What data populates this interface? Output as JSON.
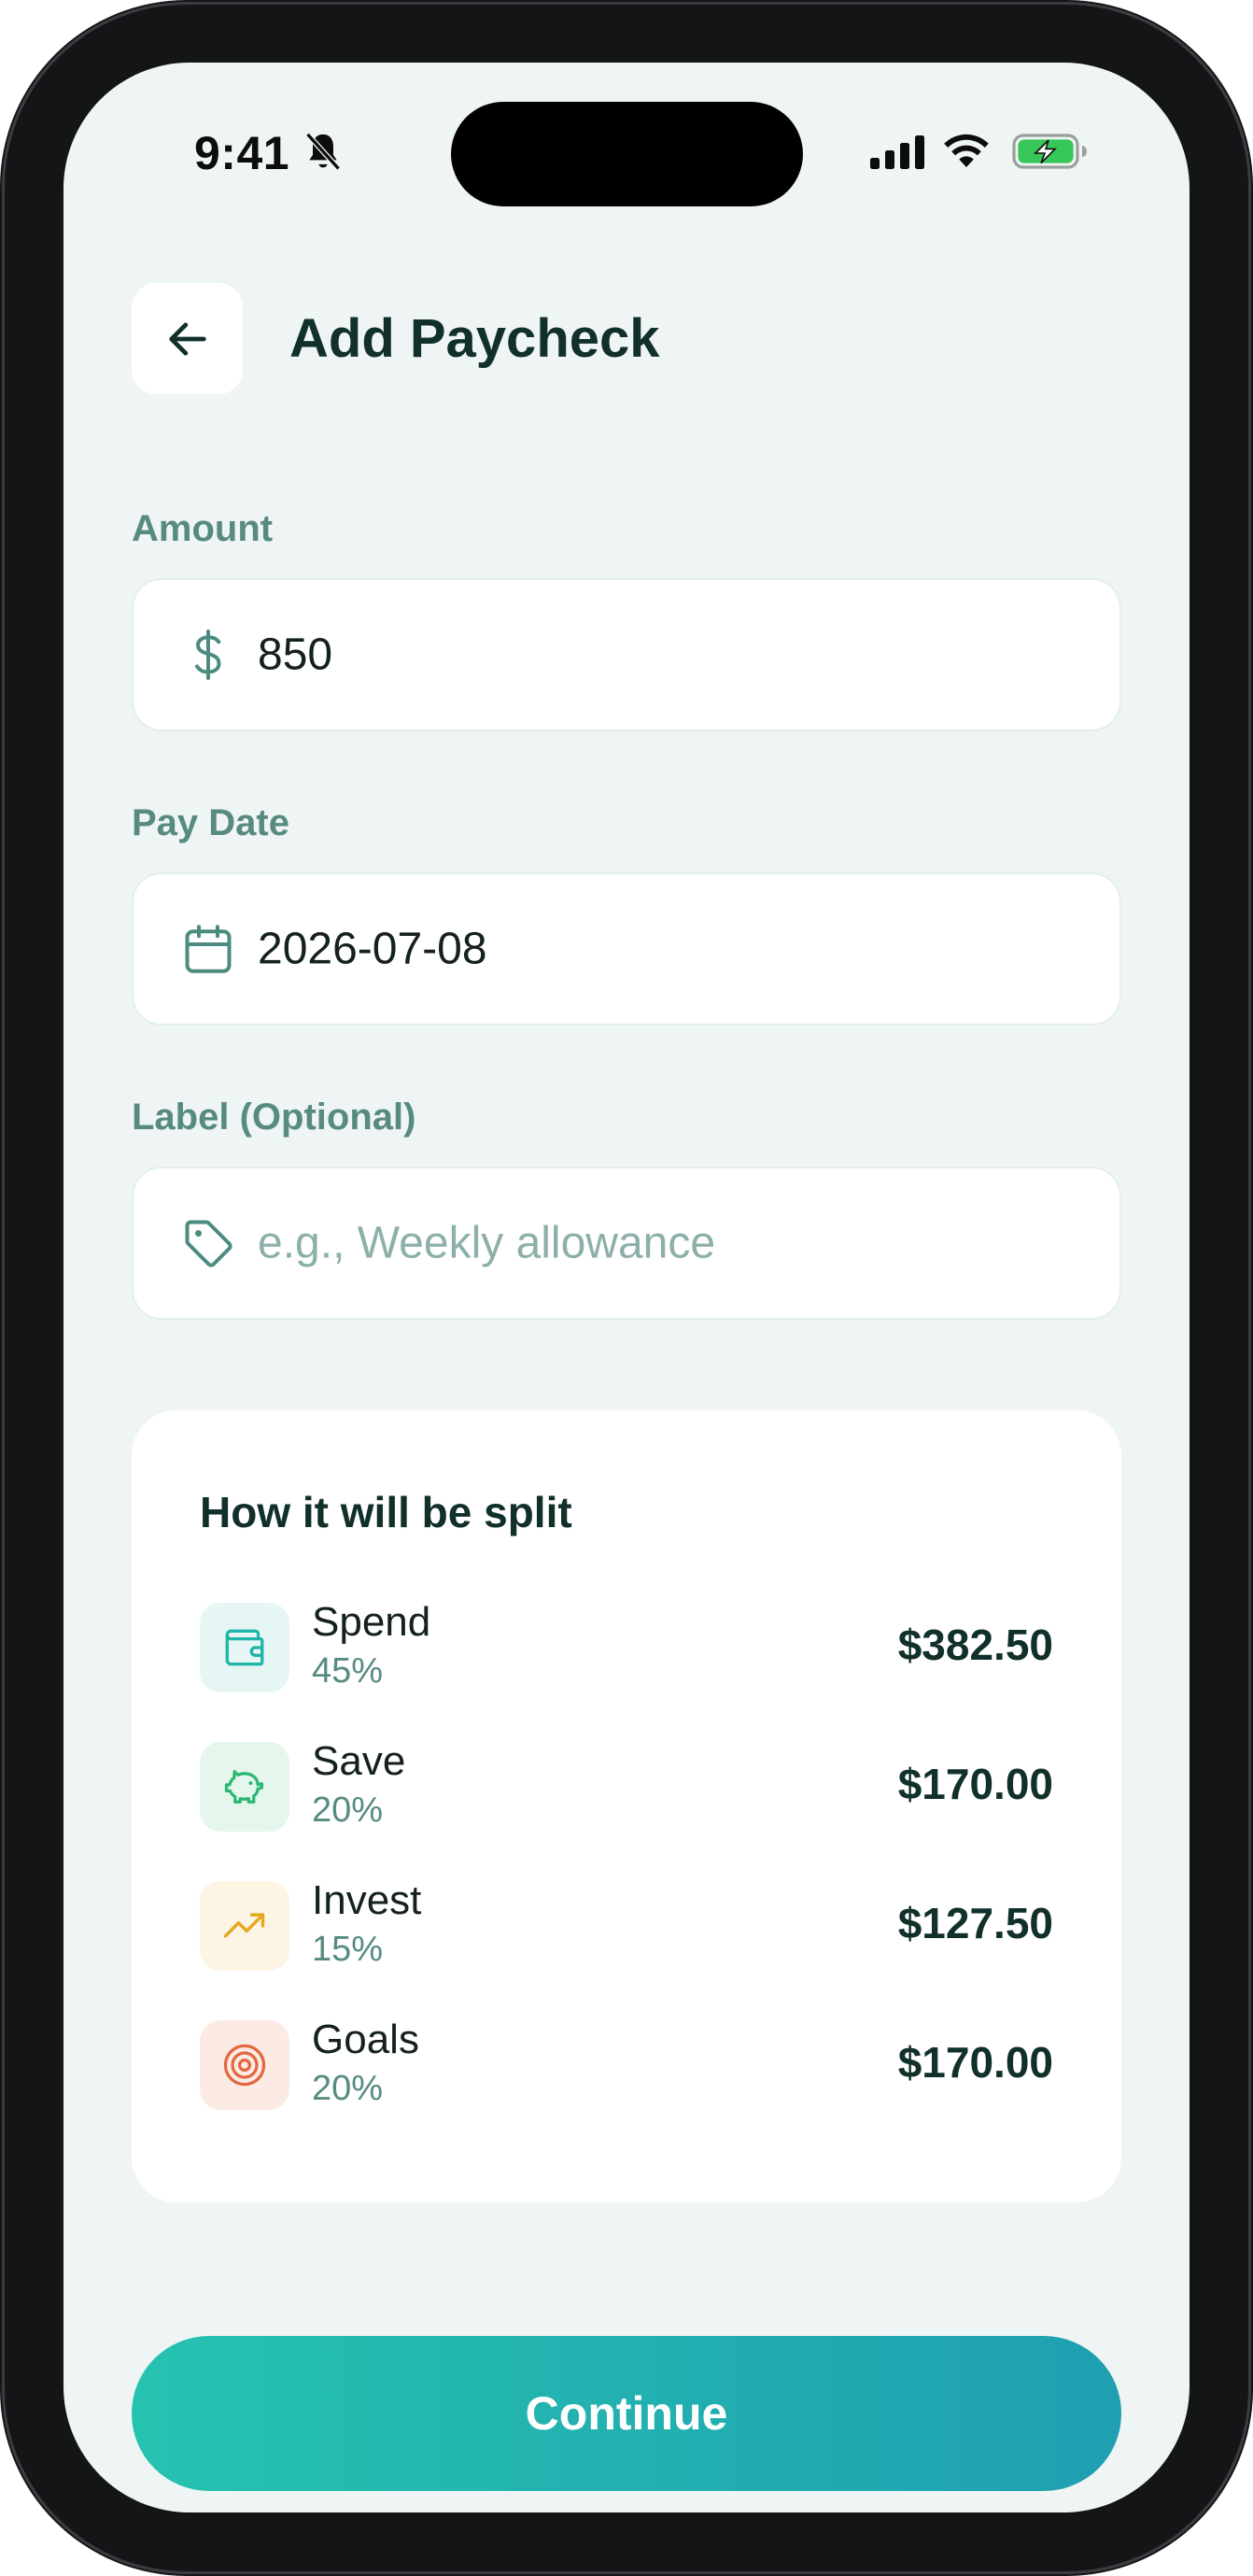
{
  "status_bar": {
    "time": "9:41",
    "icons": [
      "bell-off-icon",
      "cellular-signal-icon",
      "wifi-icon",
      "battery-charging-icon"
    ]
  },
  "header": {
    "back_icon": "arrow-left-icon",
    "title": "Add Paycheck"
  },
  "form": {
    "amount": {
      "label": "Amount",
      "icon": "dollar-icon",
      "value": "850"
    },
    "pay_date": {
      "label": "Pay Date",
      "icon": "calendar-icon",
      "value": "2026-07-08"
    },
    "label_field": {
      "label": "Label (Optional)",
      "icon": "tag-icon",
      "value": "",
      "placeholder": "e.g., Weekly allowance"
    }
  },
  "split": {
    "title": "How it will be split",
    "rows": [
      {
        "name": "Spend",
        "percent": "45%",
        "amount": "$382.50",
        "icon": "wallet-icon",
        "color": "#1fb5a8",
        "bg": "#e6f6f4"
      },
      {
        "name": "Save",
        "percent": "20%",
        "amount": "$170.00",
        "icon": "piggy-bank-icon",
        "color": "#2bb673",
        "bg": "#e5f6ec"
      },
      {
        "name": "Invest",
        "percent": "15%",
        "amount": "$127.50",
        "icon": "trending-up-icon",
        "color": "#e5a81f",
        "bg": "#fcf5e3"
      },
      {
        "name": "Goals",
        "percent": "20%",
        "amount": "$170.00",
        "icon": "target-icon",
        "color": "#e2683f",
        "bg": "#fcebe5"
      }
    ]
  },
  "footer": {
    "continue_label": "Continue"
  },
  "colors": {
    "background": "#eff5f4",
    "heading": "#12302b",
    "muted_label": "#578b82",
    "button_gradient_start": "#26c2b0",
    "button_gradient_end": "#1f9fb1"
  }
}
